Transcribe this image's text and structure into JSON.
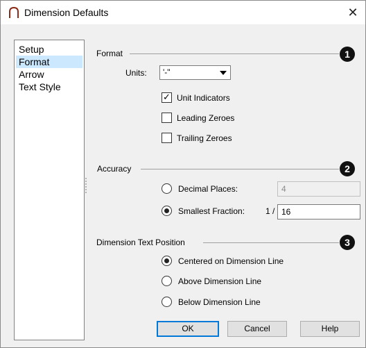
{
  "window": {
    "title": "Dimension Defaults",
    "close_glyph": "✕"
  },
  "sidebar": {
    "items": [
      {
        "label": "Setup"
      },
      {
        "label": "Format"
      },
      {
        "label": "Arrow"
      },
      {
        "label": "Text Style"
      }
    ],
    "selected": "Format"
  },
  "format": {
    "heading": "Format",
    "badge": "1",
    "units_label": "Units:",
    "units_value": "'-\"",
    "unit_indicators_label": "Unit Indicators",
    "unit_indicators_checked": true,
    "leading_zeroes_label": "Leading Zeroes",
    "leading_zeroes_checked": false,
    "trailing_zeroes_label": "Trailing Zeroes",
    "trailing_zeroes_checked": false
  },
  "accuracy": {
    "heading": "Accuracy",
    "badge": "2",
    "decimal_places_label": "Decimal Places:",
    "decimal_places_value": "4",
    "smallest_fraction_label": "Smallest Fraction:",
    "fraction_prefix": "1 /",
    "smallest_fraction_value": "16",
    "selected": "smallest_fraction"
  },
  "text_position": {
    "heading": "Dimension Text Position",
    "badge": "3",
    "options": [
      {
        "label": "Centered on Dimension Line",
        "selected": true
      },
      {
        "label": "Above Dimension Line",
        "selected": false
      },
      {
        "label": "Below Dimension Line",
        "selected": false
      }
    ]
  },
  "buttons": {
    "ok": "OK",
    "cancel": "Cancel",
    "help": "Help"
  },
  "colors": {
    "accent": "#0078d7",
    "selection": "#cce8ff",
    "badge": "#111111"
  },
  "icons": {
    "title": "arch-icon",
    "close": "close-icon",
    "dropdown": "chevron-down-icon"
  }
}
